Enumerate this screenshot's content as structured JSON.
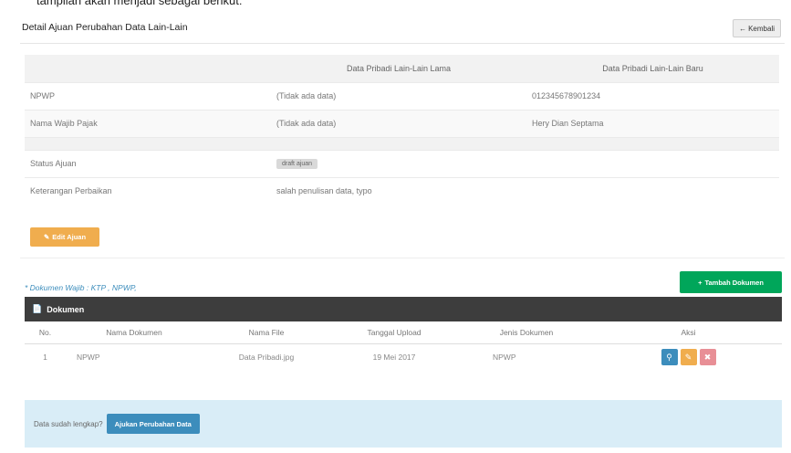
{
  "header": {
    "title": "Detail Ajuan Perubahan Data Lain-Lain",
    "back_label": "Kembali",
    "back_icon": "arrow-left-icon"
  },
  "comparison": {
    "col_old": "Data Pribadi Lain-Lain Lama",
    "col_new": "Data Pribadi Lain-Lain Baru",
    "rows": [
      {
        "label": "NPWP",
        "old": "(Tidak ada data)",
        "new": "012345678901234"
      },
      {
        "label": "Nama Wajib Pajak",
        "old": "(Tidak ada data)",
        "new": "Hery Dian Septama"
      }
    ]
  },
  "status": {
    "label": "Status Ajuan",
    "badge": "draft ajuan",
    "badge_color": "#d9d9d9"
  },
  "notes": {
    "label": "Keterangan Perbaikan",
    "value": "salah penulisan data, typo"
  },
  "edit_button": {
    "label": "Edit Ajuan",
    "icon": "pencil-icon",
    "color": "#f0ad4e"
  },
  "documents": {
    "note": "* Dokumen Wajib : KTP , NPWP,",
    "add_label": "Tambah Dokumen",
    "add_color": "#00a65a",
    "box_title": "Dokumen",
    "columns": [
      "No.",
      "Nama Dokumen",
      "Nama File",
      "Tanggal Upload",
      "Jenis Dokumen",
      "Aksi"
    ],
    "rows": [
      {
        "no": "1",
        "name": "NPWP",
        "file": "Data Pribadi.jpg",
        "date": "19 Mei 2017",
        "type": "NPWP"
      }
    ],
    "actions": [
      "search-icon",
      "pencil-icon",
      "trash-icon"
    ]
  },
  "footer": {
    "text": "Data sudah lengkap?",
    "submit_label": "Ajukan Perubahan Data",
    "bg_color": "#d9edf7",
    "button_color": "#3c8dbc"
  }
}
